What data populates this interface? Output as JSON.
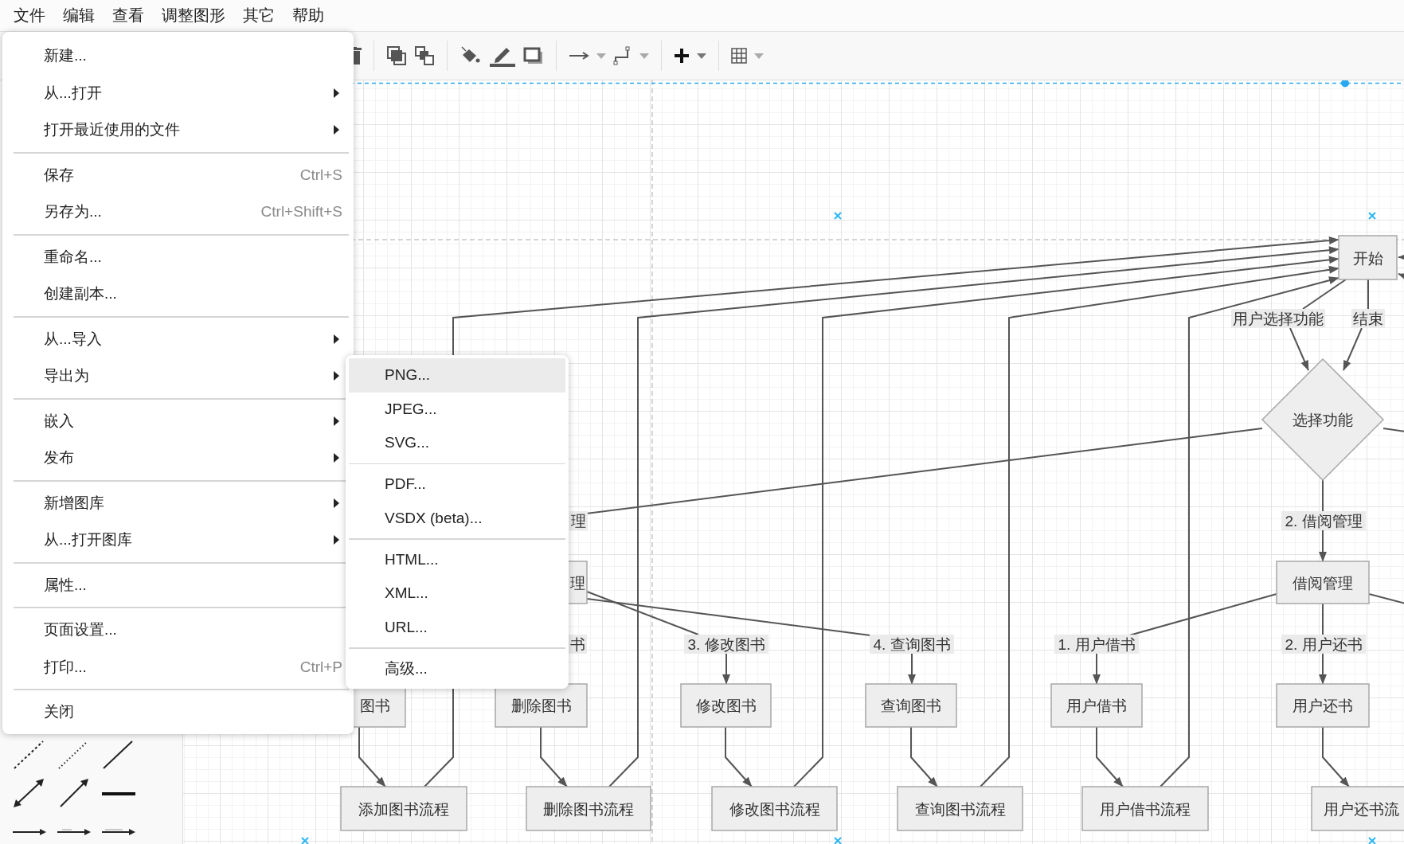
{
  "menubar": [
    {
      "label": "文件"
    },
    {
      "label": "编辑"
    },
    {
      "label": "查看"
    },
    {
      "label": "调整图形"
    },
    {
      "label": "其它"
    },
    {
      "label": "帮助"
    }
  ],
  "file_menu": {
    "items": [
      {
        "kind": "item",
        "label": "新建...",
        "submenu": false
      },
      {
        "kind": "item",
        "label": "从...打开",
        "submenu": true
      },
      {
        "kind": "item",
        "label": "打开最近使用的文件",
        "submenu": true
      },
      {
        "kind": "separator"
      },
      {
        "kind": "item",
        "label": "保存",
        "shortcut": "Ctrl+S",
        "submenu": false
      },
      {
        "kind": "item",
        "label": "另存为...",
        "shortcut": "Ctrl+Shift+S",
        "submenu": false
      },
      {
        "kind": "separator"
      },
      {
        "kind": "item",
        "label": "重命名...",
        "submenu": false
      },
      {
        "kind": "item",
        "label": "创建副本...",
        "submenu": false
      },
      {
        "kind": "separator"
      },
      {
        "kind": "item",
        "label": "从...导入",
        "submenu": true
      },
      {
        "kind": "item",
        "label": "导出为",
        "submenu": true
      },
      {
        "kind": "separator"
      },
      {
        "kind": "item",
        "label": "嵌入",
        "submenu": true
      },
      {
        "kind": "item",
        "label": "发布",
        "submenu": true
      },
      {
        "kind": "separator"
      },
      {
        "kind": "item",
        "label": "新增图库",
        "submenu": true
      },
      {
        "kind": "item",
        "label": "从...打开图库",
        "submenu": true
      },
      {
        "kind": "separator"
      },
      {
        "kind": "item",
        "label": "属性...",
        "submenu": false
      },
      {
        "kind": "separator"
      },
      {
        "kind": "item",
        "label": "页面设置...",
        "submenu": false
      },
      {
        "kind": "item",
        "label": "打印...",
        "shortcut": "Ctrl+P",
        "submenu": false
      },
      {
        "kind": "separator"
      },
      {
        "kind": "item",
        "label": "关闭",
        "submenu": false
      }
    ]
  },
  "export_submenu": {
    "items": [
      {
        "kind": "item",
        "label": "PNG...",
        "selected": true
      },
      {
        "kind": "item",
        "label": "JPEG...",
        "selected": false
      },
      {
        "kind": "item",
        "label": "SVG...",
        "selected": false
      },
      {
        "kind": "separator"
      },
      {
        "kind": "item",
        "label": "PDF...",
        "selected": false
      },
      {
        "kind": "item",
        "label": "VSDX (beta)...",
        "selected": false
      },
      {
        "kind": "separator"
      },
      {
        "kind": "item",
        "label": "HTML...",
        "selected": false
      },
      {
        "kind": "item",
        "label": "XML...",
        "selected": false
      },
      {
        "kind": "item",
        "label": "URL...",
        "selected": false
      },
      {
        "kind": "separator"
      },
      {
        "kind": "item",
        "label": "高级...",
        "selected": false
      }
    ]
  },
  "diagram": {
    "nodes": [
      {
        "kind": "rect",
        "label": "开始"
      },
      {
        "kind": "diamond",
        "label": "选择功能"
      },
      {
        "kind": "rect",
        "label": "理"
      },
      {
        "kind": "rect",
        "label": "借阅管理"
      },
      {
        "kind": "rect",
        "label": "图书"
      },
      {
        "kind": "rect",
        "label": "删除图书"
      },
      {
        "kind": "rect",
        "label": "修改图书"
      },
      {
        "kind": "rect",
        "label": "查询图书"
      },
      {
        "kind": "rect",
        "label": "用户借书"
      },
      {
        "kind": "rect",
        "label": "用户还书"
      },
      {
        "kind": "rect",
        "label": "添加图书流程"
      },
      {
        "kind": "rect",
        "label": "删除图书流程"
      },
      {
        "kind": "rect",
        "label": "修改图书流程"
      },
      {
        "kind": "rect",
        "label": "查询图书流程"
      },
      {
        "kind": "rect",
        "label": "用户借书流程"
      },
      {
        "kind": "rect",
        "label": "用户还书流"
      }
    ],
    "edge_labels": [
      {
        "label": "用户选择功能"
      },
      {
        "label": "结束"
      },
      {
        "label": "理"
      },
      {
        "label": "2. 借阅管理"
      },
      {
        "label": "书"
      },
      {
        "label": "3. 修改图书"
      },
      {
        "label": "4. 查询图书"
      },
      {
        "label": "1. 用户借书"
      },
      {
        "label": "2. 用户还书"
      }
    ]
  }
}
